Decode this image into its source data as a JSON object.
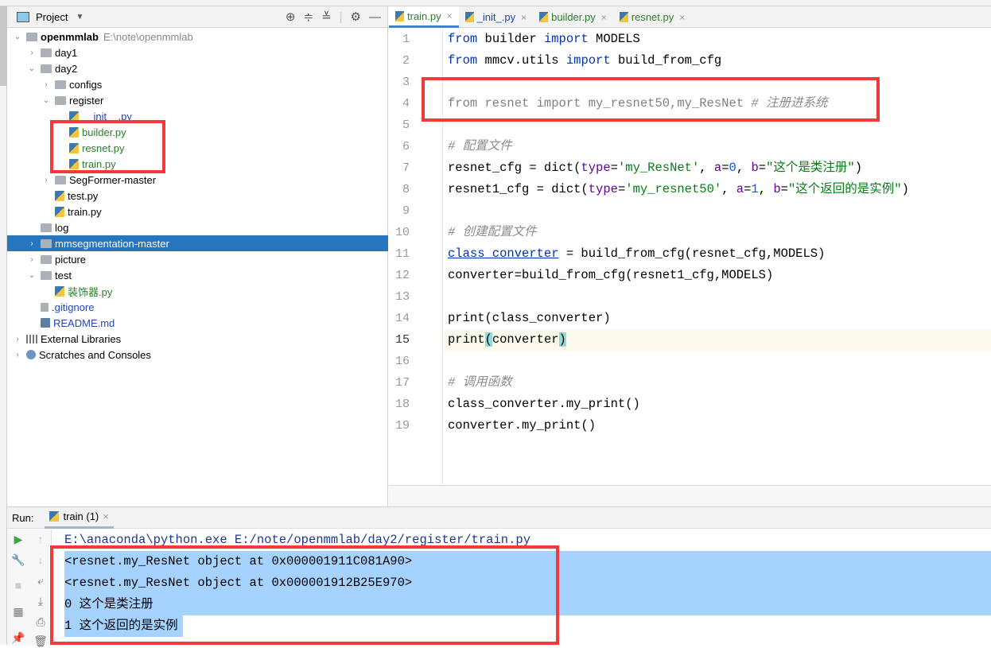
{
  "project_panel": {
    "title": "Project",
    "root": {
      "name": "openmmlab",
      "path": "E:\\note\\openmmlab"
    },
    "tree": [
      {
        "label": "day1",
        "level": 1,
        "arrow": "right",
        "icon": "folder"
      },
      {
        "label": "day2",
        "level": 1,
        "arrow": "down",
        "icon": "folder"
      },
      {
        "label": "configs",
        "level": 2,
        "arrow": "right",
        "icon": "folder"
      },
      {
        "label": "register",
        "level": 2,
        "arrow": "down",
        "icon": "package"
      },
      {
        "label": "__init__.py",
        "level": 3,
        "icon": "python",
        "color": "blue"
      },
      {
        "label": "builder.py",
        "level": 3,
        "icon": "python",
        "color": "green"
      },
      {
        "label": "resnet.py",
        "level": 3,
        "icon": "python",
        "color": "green"
      },
      {
        "label": "train.py",
        "level": 3,
        "icon": "python",
        "color": "green"
      },
      {
        "label": "SegFormer-master",
        "level": 2,
        "arrow": "right",
        "icon": "folder"
      },
      {
        "label": "test.py",
        "level": 2,
        "icon": "python"
      },
      {
        "label": "train.py",
        "level": 2,
        "icon": "python"
      },
      {
        "label": "log",
        "level": 1,
        "icon": "folder"
      },
      {
        "label": "mmsegmentation-master",
        "level": 1,
        "arrow": "right",
        "icon": "folder",
        "selected": true
      },
      {
        "label": "picture",
        "level": 1,
        "arrow": "right",
        "icon": "folder"
      },
      {
        "label": "test",
        "level": 1,
        "arrow": "down",
        "icon": "folder"
      },
      {
        "label": "装饰器.py",
        "level": 2,
        "icon": "python",
        "color": "green"
      },
      {
        "label": ".gitignore",
        "level": 1,
        "icon": "git",
        "color": "blue"
      },
      {
        "label": "README.md",
        "level": 1,
        "icon": "markdown",
        "color": "blue"
      },
      {
        "label": "External Libraries",
        "level": 0,
        "arrow": "right",
        "icon": "library"
      },
      {
        "label": "Scratches and Consoles",
        "level": 0,
        "arrow": "right",
        "icon": "scratches"
      }
    ]
  },
  "editor": {
    "tabs": [
      {
        "label": "train.py",
        "active": true,
        "color": "green"
      },
      {
        "label": "_init_.py",
        "color": "blue"
      },
      {
        "label": "builder.py",
        "color": "green"
      },
      {
        "label": "resnet.py",
        "color": "green"
      }
    ],
    "current_line": 15,
    "lines": [
      [
        [
          "from",
          "kw"
        ],
        [
          " builder ",
          ""
        ],
        [
          "import",
          "kw"
        ],
        [
          " MODELS",
          ""
        ]
      ],
      [
        [
          "from",
          "kw"
        ],
        [
          " mmcv.utils ",
          ""
        ],
        [
          "import",
          "kw"
        ],
        [
          " build_from_cfg",
          ""
        ]
      ],
      [],
      [
        [
          "from resnet import my_resnet50,my_ResNet ",
          "dim"
        ],
        [
          "# 注册进系统",
          "cm"
        ]
      ],
      [],
      [
        [
          "# 配置文件",
          "cm"
        ]
      ],
      [
        [
          "resnet_cfg = dict(",
          ""
        ],
        [
          "type",
          "kwd"
        ],
        [
          "=",
          ""
        ],
        [
          "'my_ResNet'",
          "str"
        ],
        [
          ", ",
          ""
        ],
        [
          "a",
          "kwd"
        ],
        [
          "=",
          ""
        ],
        [
          "0",
          "num"
        ],
        [
          ", ",
          ""
        ],
        [
          "b",
          "kwd"
        ],
        [
          "=",
          ""
        ],
        [
          "\"这个是类注册\"",
          "str"
        ],
        [
          ")",
          ""
        ]
      ],
      [
        [
          "resnet1_cfg = dict(",
          ""
        ],
        [
          "type",
          "kwd"
        ],
        [
          "=",
          ""
        ],
        [
          "'my_resnet50'",
          "str"
        ],
        [
          ", ",
          ""
        ],
        [
          "a",
          "kwd"
        ],
        [
          "=",
          ""
        ],
        [
          "1",
          "num"
        ],
        [
          ", ",
          ""
        ],
        [
          "b",
          "kwd"
        ],
        [
          "=",
          ""
        ],
        [
          "\"这个返回的是实例\"",
          "str"
        ],
        [
          ")",
          ""
        ]
      ],
      [],
      [
        [
          "# 创建配置文件",
          "cm"
        ]
      ],
      [
        [
          "class_converter",
          "ul"
        ],
        [
          " = build_from_cfg(resnet_cfg,MODELS)",
          ""
        ]
      ],
      [
        [
          "converter=build_from_cfg(resnet1_cfg,MODELS)",
          ""
        ]
      ],
      [],
      [
        [
          "print(class_converter)",
          ""
        ]
      ],
      [
        [
          "print",
          ""
        ],
        [
          "(",
          "br"
        ],
        [
          "converter",
          ""
        ],
        [
          ")",
          "br"
        ]
      ],
      [],
      [
        [
          "# 调用函数",
          "cm"
        ]
      ],
      [
        [
          "class_converter.my_print()",
          ""
        ]
      ],
      [
        [
          "converter.my_print()",
          ""
        ]
      ]
    ]
  },
  "run_panel": {
    "label": "Run:",
    "tab": "train (1)",
    "output": [
      "E:\\anaconda\\python.exe E:/note/openmmlab/day2/register/train.py",
      "<resnet.my_ResNet object at 0x000001911C081A90>",
      "<resnet.my_ResNet object at 0x000001912B25E970>",
      "0 这个是类注册",
      "1 这个返回的是实例"
    ]
  },
  "colors": {
    "selection": "#2675bf",
    "console_highlight": "#a6d2ff",
    "annotation": "#f23a3a"
  }
}
